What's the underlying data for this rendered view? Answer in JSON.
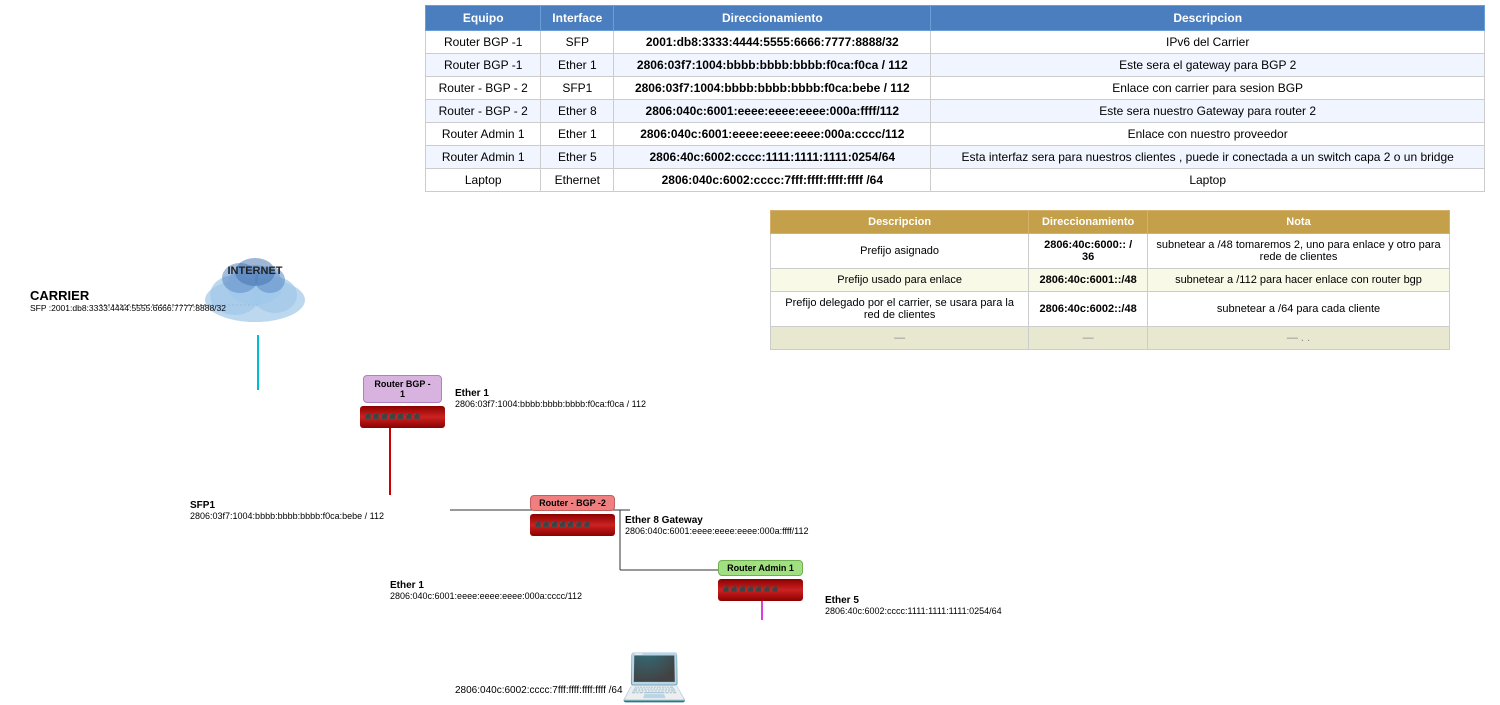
{
  "mainTable": {
    "headers": [
      "Equipo",
      "Interface",
      "Direccionamiento",
      "Descripcion"
    ],
    "rows": [
      {
        "equipo": "Router BGP -1",
        "interface": "SFP",
        "direccionamiento": "2001:db8:3333:4444:5555:6666:7777:8888/32",
        "descripcion": "IPv6 del Carrier"
      },
      {
        "equipo": "Router BGP -1",
        "interface": "Ether 1",
        "direccionamiento": "2806:03f7:1004:bbbb:bbbb:bbbb:f0ca:f0ca / 112",
        "descripcion": "Este sera el gateway para BGP 2"
      },
      {
        "equipo": "Router - BGP - 2",
        "interface": "SFP1",
        "direccionamiento": "2806:03f7:1004:bbbb:bbbb:bbbb:f0ca:bebe / 112",
        "descripcion": "Enlace con carrier para sesion BGP"
      },
      {
        "equipo": "Router - BGP - 2",
        "interface": "Ether 8",
        "direccionamiento": "2806:040c:6001:eeee:eeee:eeee:000a:ffff/112",
        "descripcion": "Este sera nuestro Gateway para router 2"
      },
      {
        "equipo": "Router Admin 1",
        "interface": "Ether 1",
        "direccionamiento": "2806:040c:6001:eeee:eeee:eeee:000a:cccc/112",
        "descripcion": "Enlace con nuestro proveedor"
      },
      {
        "equipo": "Router Admin 1",
        "interface": "Ether 5",
        "direccionamiento": "2806:40c:6002:cccc:1111:1111:1111:0254/64",
        "descripcion": "Esta interfaz sera para nuestros clientes , puede ir conectada a un switch capa 2 o un bridge"
      },
      {
        "equipo": "Laptop",
        "interface": "Ethernet",
        "direccionamiento": "2806:040c:6002:cccc:7fff:ffff:ffff:ffff /64",
        "descripcion": "Laptop"
      }
    ]
  },
  "secondaryTable": {
    "headers": [
      "Descripcion",
      "Direccionamiento",
      "Nota"
    ],
    "rows": [
      {
        "descripcion": "Prefijo asignado",
        "direccionamiento": "2806:40c:6000:: / 36",
        "nota": "subnetear a /48  tomaremos 2, uno para enlace y otro para rede de clientes"
      },
      {
        "descripcion": "Prefijo usado para enlace",
        "direccionamiento": "2806:40c:6001::/48",
        "nota": "subnetear a /112 para hacer enlace con router bgp"
      },
      {
        "descripcion": "Prefijo delegado por el carrier, se usara para la red de clientes",
        "direccionamiento": "2806:40c:6002::/48",
        "nota": "subnetear a /64 para cada cliente"
      },
      {
        "descripcion": "—",
        "direccionamiento": "—",
        "nota": "— . ."
      }
    ]
  },
  "diagram": {
    "internet_label": "INTERNET",
    "carrier_label": "CARRIER",
    "carrier_addr": "SFP :2001:db8:3333:4444:5555:6666:7777:8888/32",
    "router_bgp1_label": "Router BGP -\n1",
    "router_bgp1_ether1_label": "Ether 1",
    "router_bgp1_ether1_addr": "2806:03f7:1004:bbbb:bbbb:bbbb:f0ca:f0ca / 112",
    "router_bgp2_label": "Router - BGP -2",
    "router_bgp2_sfp1_label": "SFP1",
    "router_bgp2_sfp1_addr": "2806:03f7:1004:bbbb:bbbb:bbbb:f0ca:bebe / 112",
    "router_bgp2_ether8_label": "Ether 8 Gateway",
    "router_bgp2_ether8_addr": "2806:040c:6001:eeee:eeee:eeee:000a:ffff/112",
    "router_admin1_label": "Router Admin 1",
    "router_admin1_ether1_label": "Ether 1",
    "router_admin1_ether1_addr": "2806:040c:6001:eeee:eeee:eeee:000a:cccc/112",
    "router_admin1_ether5_label": "Ether 5",
    "router_admin1_ether5_addr": "2806:40c:6002:cccc:1111:1111:1111:0254/64",
    "laptop_addr": "2806:040c:6002:cccc:7fff:ffff:ffff:ffff /64"
  }
}
